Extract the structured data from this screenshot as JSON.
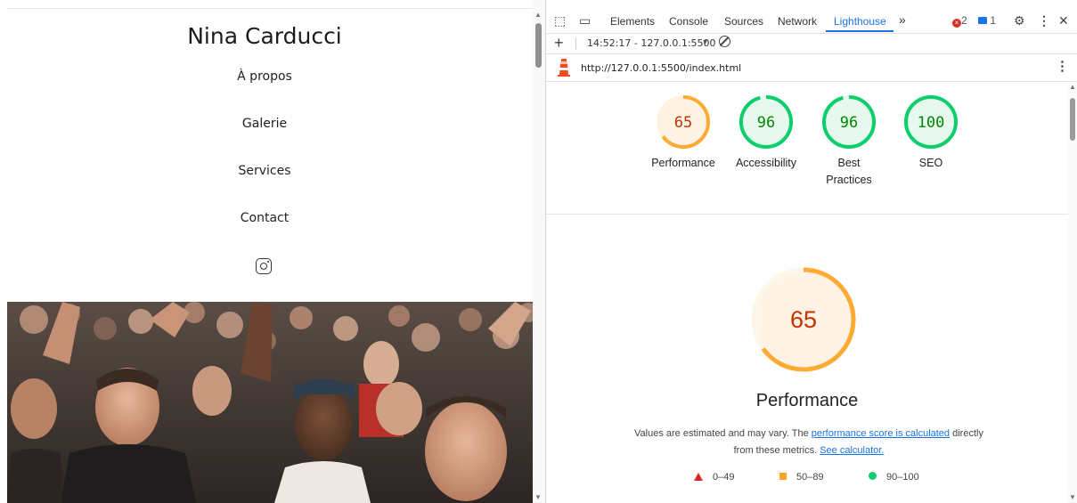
{
  "site": {
    "brand": "Nina Carducci",
    "nav": [
      "À propos",
      "Galerie",
      "Services",
      "Contact"
    ]
  },
  "devtools": {
    "tabs": [
      "Elements",
      "Console",
      "Sources",
      "Network",
      "Lighthouse"
    ],
    "active_tab": "Lighthouse",
    "more": "»",
    "errors_count": "2",
    "messages_count": "1",
    "report_select": "14:52:17 - 127.0.0.1:5500",
    "url": "http://127.0.0.1:5500/index.html",
    "scores": [
      {
        "label": "Performance",
        "score": "65",
        "color": "#fa3",
        "text_color": "#c33300",
        "bg": "#fff3e6"
      },
      {
        "label": "Accessibility",
        "score": "96",
        "color": "#0cce6b",
        "text_color": "#008800",
        "bg": "#e7f8ee"
      },
      {
        "label": "Best Practices",
        "score": "96",
        "color": "#0cce6b",
        "text_color": "#008800",
        "bg": "#e7f8ee"
      },
      {
        "label": "SEO",
        "score": "100",
        "color": "#0cce6b",
        "text_color": "#008800",
        "bg": "#e7f8ee"
      }
    ],
    "main_score": "65",
    "main_title": "Performance",
    "desc_before": "Values are estimated and may vary. The ",
    "desc_link1": "performance score is calculated",
    "desc_middle": " directly from these metrics. ",
    "desc_link2": "See calculator.",
    "legend": [
      "0–49",
      "50–89",
      "90–100"
    ]
  }
}
